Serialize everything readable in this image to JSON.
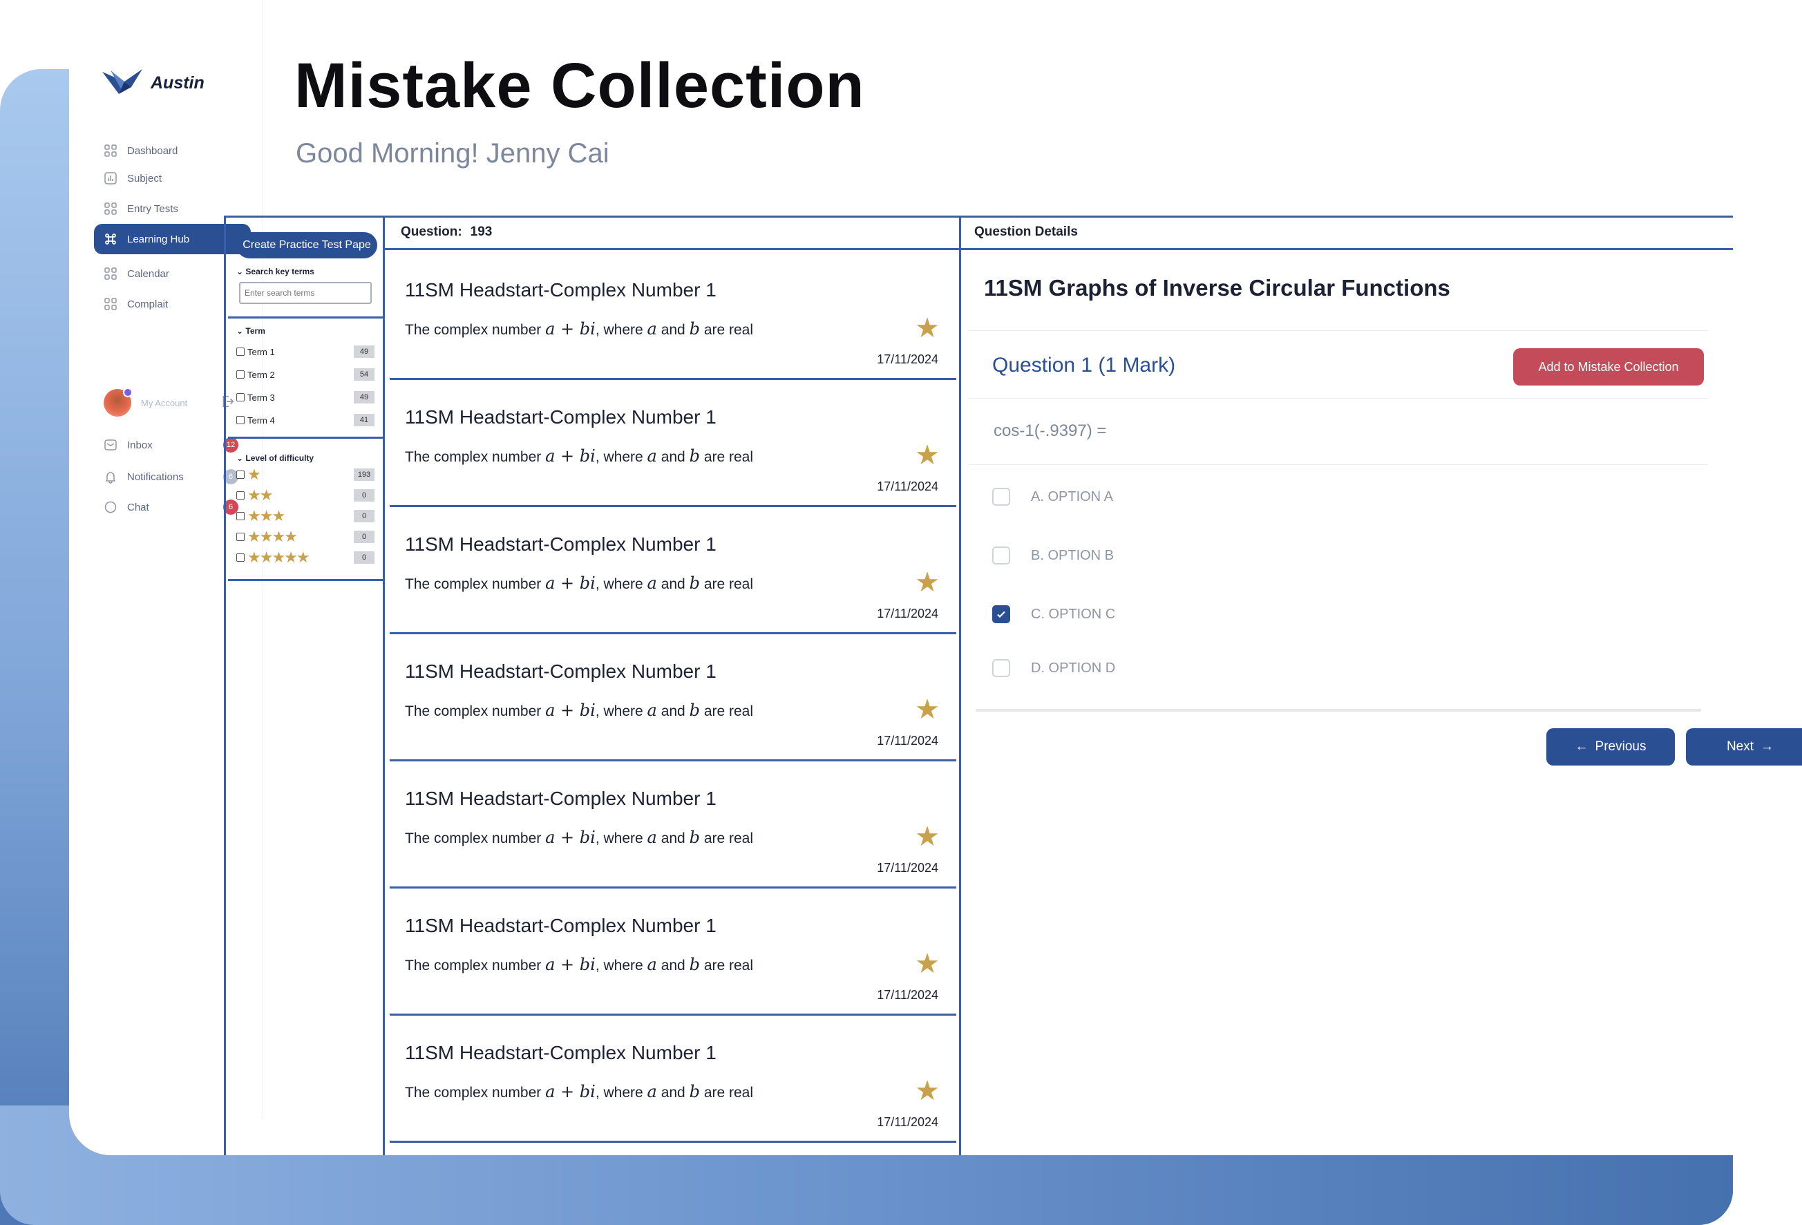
{
  "brand": {
    "name": "Austin"
  },
  "sidebar": {
    "items": [
      {
        "label": "Dashboard",
        "icon": "grid-icon",
        "active": false,
        "badge": null
      },
      {
        "label": "Subject",
        "icon": "chart-icon",
        "active": false,
        "badge": null
      },
      {
        "label": "Entry Tests",
        "icon": "grid-icon",
        "active": false,
        "badge": null
      },
      {
        "label": "Learning Hub",
        "icon": "command-icon",
        "active": true,
        "badge": null
      },
      {
        "label": "Calendar",
        "icon": "grid-icon",
        "active": false,
        "badge": null
      },
      {
        "label": "Complait",
        "icon": "grid-icon",
        "active": false,
        "badge": null
      }
    ],
    "account": {
      "label": "My Account"
    },
    "bottom_items": [
      {
        "label": "Inbox",
        "icon": "mail-icon",
        "badge": "12"
      },
      {
        "label": "Notifications",
        "icon": "bell-icon",
        "badge": "6"
      },
      {
        "label": "Chat",
        "icon": "chat-icon",
        "badge": "6"
      }
    ]
  },
  "header": {
    "title": "Mistake Collection",
    "greeting": "Good Morning! Jenny Cai"
  },
  "filters": {
    "create_button": "Create Practice Test Pape",
    "search_label": "Search key terms",
    "search_placeholder": "Enter search terms",
    "term_label": "Term",
    "terms": [
      {
        "label": "Term 1",
        "count": "49"
      },
      {
        "label": "Term 2",
        "count": "54"
      },
      {
        "label": "Term 3",
        "count": "49"
      },
      {
        "label": "Term 4",
        "count": "41"
      }
    ],
    "difficulty_label": "Level of difficulty",
    "difficulty": [
      {
        "stars": "★",
        "count": "193"
      },
      {
        "stars": "★★",
        "count": "0"
      },
      {
        "stars": "★★★",
        "count": "0"
      },
      {
        "stars": "★★★★",
        "count": "0"
      },
      {
        "stars": "★★★★★",
        "count": "0"
      }
    ]
  },
  "question_list": {
    "header_label": "Question:",
    "header_count": "193",
    "items": [
      {
        "title": "11SM Headstart-Complex Number 1",
        "text_a": "The complex number",
        "math": "a + bi",
        "text_b": ", where",
        "var_a": "a",
        "text_c": "and",
        "var_b": "b",
        "text_d": "are real",
        "date": "17/11/2024"
      },
      {
        "title": "11SM Headstart-Complex Number 1",
        "text_a": "The complex number",
        "math": "a + bi",
        "text_b": ", where",
        "var_a": "a",
        "text_c": "and",
        "var_b": "b",
        "text_d": "are real",
        "date": "17/11/2024"
      },
      {
        "title": "11SM Headstart-Complex Number 1",
        "text_a": "The complex number",
        "math": "a + bi",
        "text_b": ", where",
        "var_a": "a",
        "text_c": "and",
        "var_b": "b",
        "text_d": "are real",
        "date": "17/11/2024"
      },
      {
        "title": "11SM Headstart-Complex Number 1",
        "text_a": "The complex number",
        "math": "a + bi",
        "text_b": ", where",
        "var_a": "a",
        "text_c": "and",
        "var_b": "b",
        "text_d": "are real",
        "date": "17/11/2024"
      },
      {
        "title": "11SM Headstart-Complex Number 1",
        "text_a": "The complex number",
        "math": "a + bi",
        "text_b": ", where",
        "var_a": "a",
        "text_c": "and",
        "var_b": "b",
        "text_d": "are real",
        "date": "17/11/2024"
      },
      {
        "title": "11SM Headstart-Complex Number 1",
        "text_a": "The complex number",
        "math": "a + bi",
        "text_b": ", where",
        "var_a": "a",
        "text_c": "and",
        "var_b": "b",
        "text_d": "are real",
        "date": "17/11/2024"
      },
      {
        "title": "11SM Headstart-Complex Number 1",
        "text_a": "The complex number",
        "math": "a + bi",
        "text_b": ", where",
        "var_a": "a",
        "text_c": "and",
        "var_b": "b",
        "text_d": "are real",
        "date": "17/11/2024"
      }
    ]
  },
  "details": {
    "header": "Question Details",
    "title": "11SM Graphs of Inverse Circular Functions",
    "question_label": "Question 1  (1 Mark)",
    "add_button": "Add to Mistake Collection",
    "formula": "cos-1(-.9397) =",
    "options": [
      {
        "label": "A. OPTION A",
        "checked": false
      },
      {
        "label": "B. OPTION B",
        "checked": false
      },
      {
        "label": "C. OPTION C",
        "checked": true
      },
      {
        "label": "D. OPTION D",
        "checked": false
      }
    ],
    "previous_label": "Previous",
    "next_label": "Next"
  },
  "colors": {
    "primary": "#2b4f93",
    "accent_red": "#c44b59",
    "star": "#c9a14a",
    "badge_red": "#d64654"
  }
}
